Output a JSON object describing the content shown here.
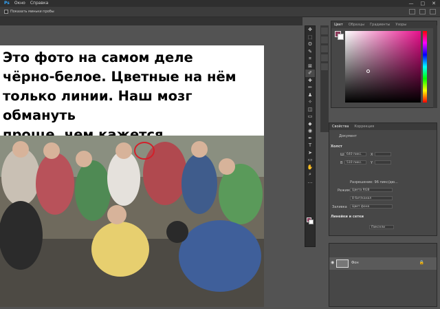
{
  "menubar": {
    "items": [
      "Окно",
      "Справка"
    ],
    "window_controls": [
      "—",
      "□",
      "✕"
    ]
  },
  "options": {
    "show_tooltips": "Показать миньки пробы"
  },
  "canvas": {
    "caption": "Это фото на самом деле\nчёрно-белое. Цветные на нём\nтолько линии. Наш мозг обмануть\nпроще, чем кажется."
  },
  "tools": {
    "icons": [
      "move-icon",
      "marquee-icon",
      "lasso-icon",
      "quick-select-icon",
      "crop-icon",
      "frame-icon",
      "eyedropper-icon",
      "healing-icon",
      "brush-icon",
      "stamp-icon",
      "history-brush-icon",
      "eraser-icon",
      "gradient-icon",
      "blur-icon",
      "dodge-icon",
      "pen-icon",
      "type-icon",
      "path-select-icon",
      "shape-icon",
      "hand-icon",
      "zoom-icon",
      "more-icon"
    ],
    "glyphs": [
      "✥",
      "⬚",
      "ʘ",
      "✎",
      "⌗",
      "⊠",
      "✐",
      "✚",
      "✏",
      "♟",
      "✧",
      "◫",
      "▭",
      "◆",
      "◉",
      "✒",
      "T",
      "➤",
      "▭",
      "✋",
      "⌕",
      "…"
    ]
  },
  "color_panel": {
    "tabs": [
      "Цвет",
      "Образцы",
      "Градиенты",
      "Узоры"
    ],
    "fg_color": "#8c3a5a",
    "bg_color": "#ffffff"
  },
  "properties": {
    "tabs": [
      "Свойства",
      "Коррекция"
    ],
    "doc_label": "Документ",
    "canvas_section": "Холст",
    "width_label": "Ш",
    "width_value": "640 пикс.",
    "height_label": "В",
    "height_value": "510 пикс.",
    "x_label": "X",
    "y_label": "Y",
    "resolution": "Разрешение: 96 пикс/дю...",
    "mode_label": "Режим",
    "mode_value": "Цвета RGB",
    "bits_value": "8 бит/канал",
    "fill_label": "Заливка",
    "fill_value": "Цвет фона",
    "guides_section": "Линейки и сетки",
    "units_value": "Пиксели"
  },
  "layers": {
    "layer_name": "Фон"
  }
}
